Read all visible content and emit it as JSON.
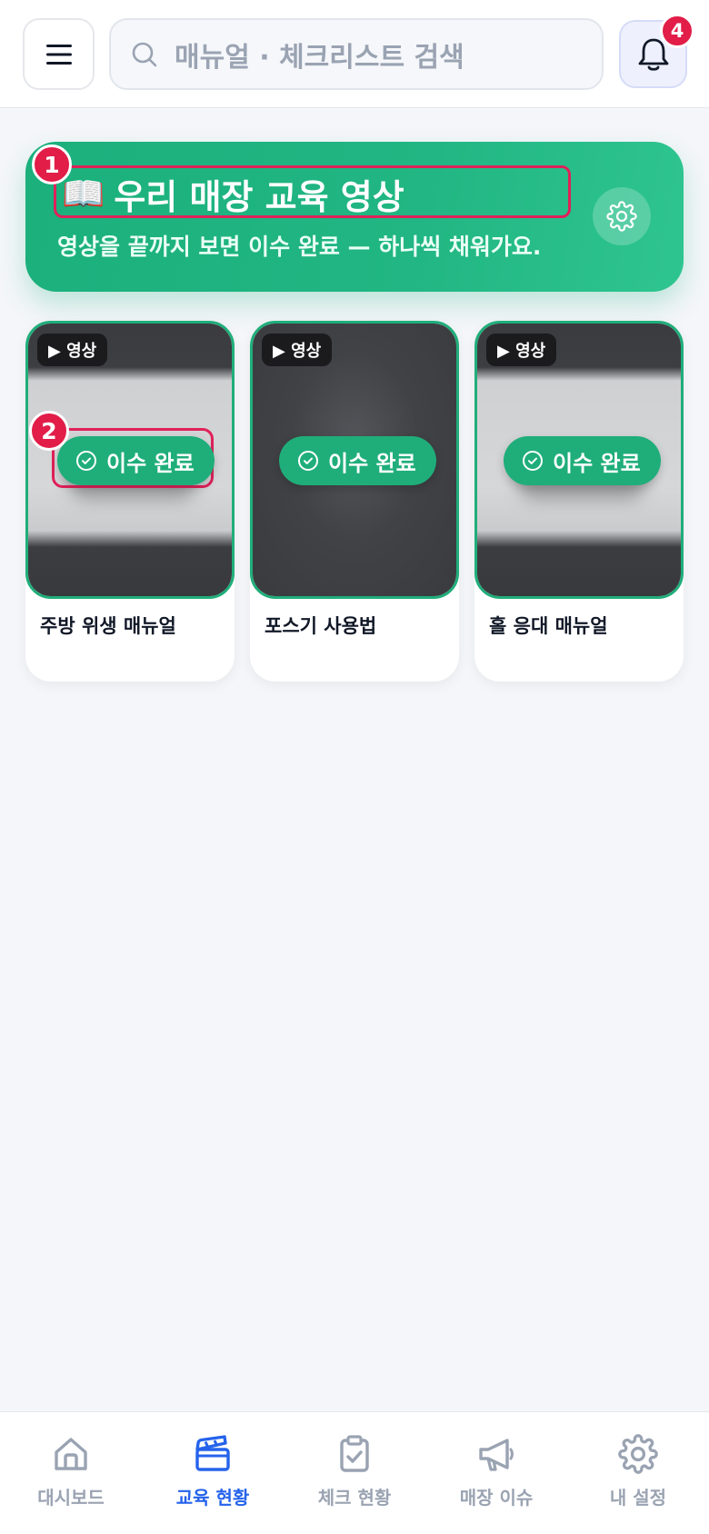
{
  "header": {
    "search_placeholder": "매뉴얼 · 체크리스트 검색",
    "notification_count": "4"
  },
  "banner": {
    "title_emoji": "📖",
    "title": "우리 매장 교육 영상",
    "subtitle": "영상을 끝까지 보면 이수 완료 — 하나씩 채워가요."
  },
  "markers": [
    "1",
    "2"
  ],
  "videos": [
    {
      "badge": "▶ 영상",
      "status": "이수 완료",
      "title": "주방 위생 매뉴얼"
    },
    {
      "badge": "▶ 영상",
      "status": "이수 완료",
      "title": "포스기 사용법"
    },
    {
      "badge": "▶ 영상",
      "status": "이수 완료",
      "title": "홀 응대 매뉴얼"
    }
  ],
  "bottom_nav": [
    {
      "label": "대시보드",
      "icon": "home-icon"
    },
    {
      "label": "교육 현황",
      "icon": "clapperboard-icon",
      "active": true
    },
    {
      "label": "체크 현황",
      "icon": "clipboard-check-icon"
    },
    {
      "label": "매장 이슈",
      "icon": "megaphone-icon"
    },
    {
      "label": "내 설정",
      "icon": "gear-icon"
    }
  ],
  "colors": {
    "accent_green": "#1fae7a",
    "active_blue": "#2563eb",
    "highlight_red": "#e11d48"
  }
}
